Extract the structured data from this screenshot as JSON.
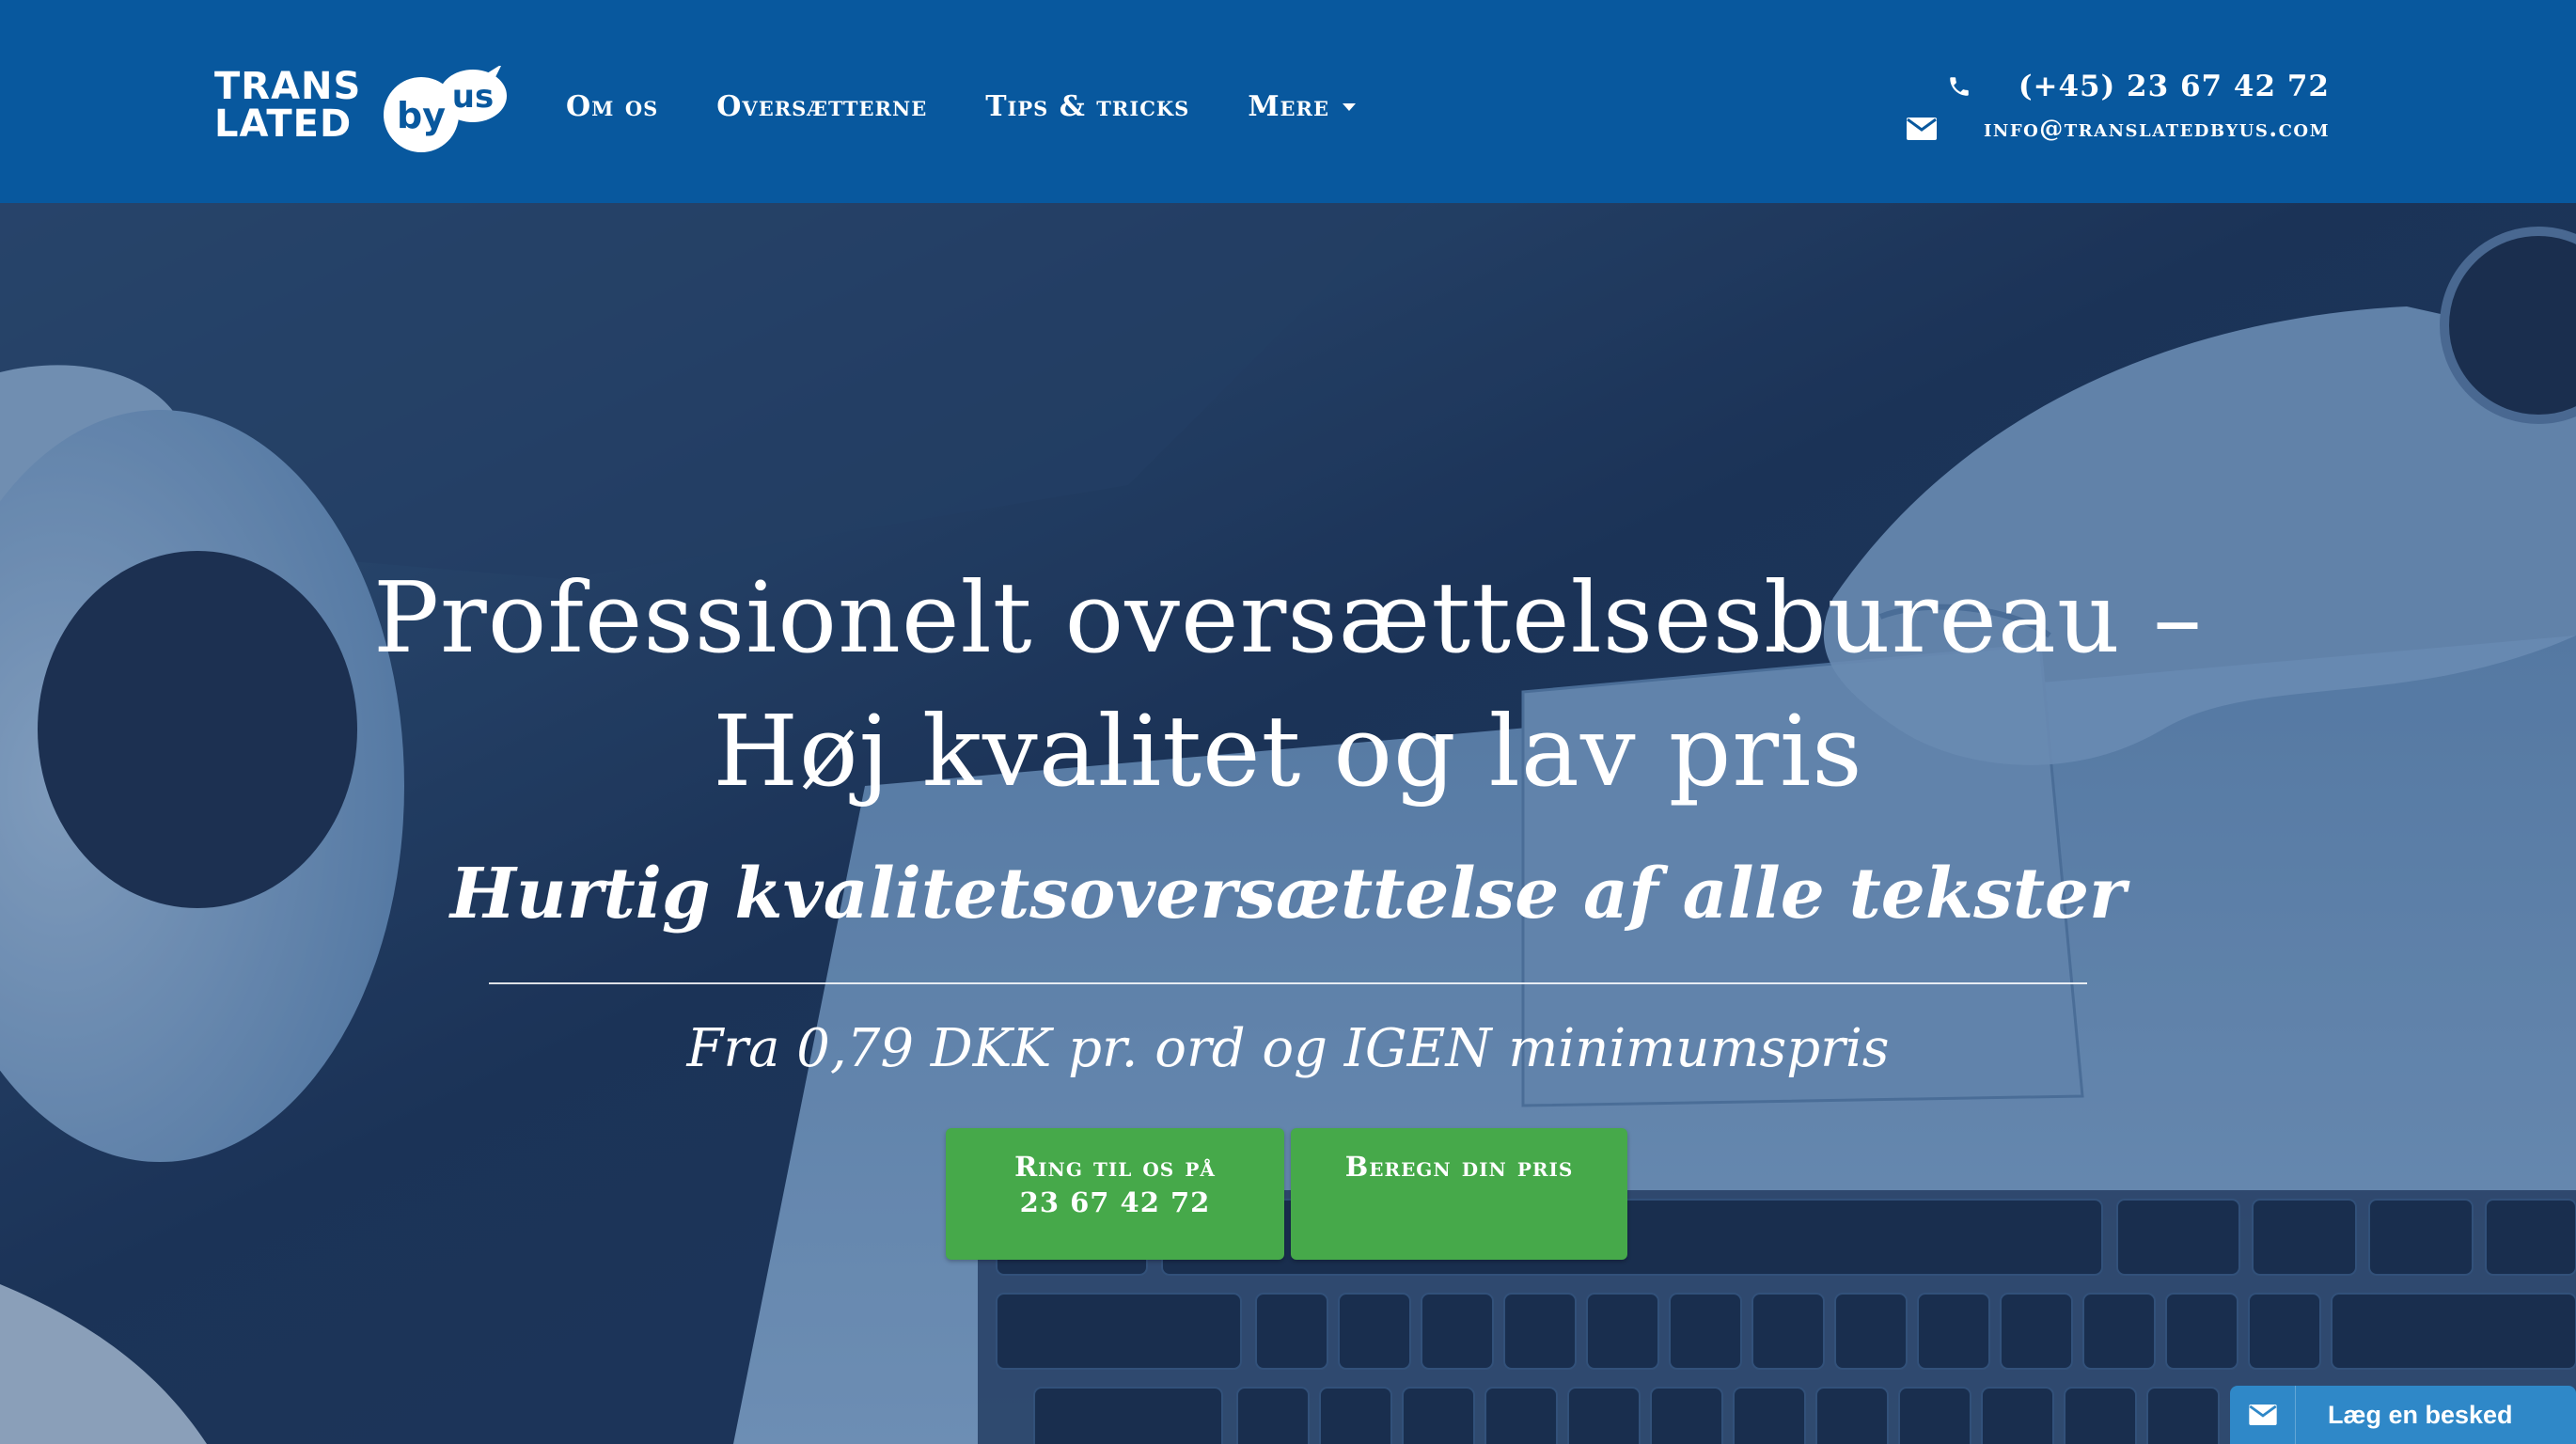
{
  "brand": {
    "logo_line1": "TRANS",
    "logo_line2": "LATED",
    "logo_by": "by",
    "logo_us": "us",
    "color_primary": "#08589e",
    "color_button": "#46a94a",
    "color_chat": "#2f88c8"
  },
  "nav": {
    "items": [
      {
        "label": "Om os"
      },
      {
        "label": "Oversætterne"
      },
      {
        "label": "Tips & tricks"
      },
      {
        "label": "Mere",
        "has_dropdown": true
      }
    ]
  },
  "contact": {
    "phone": "(+45) 23 67 42 72",
    "phone_icon": "phone-icon",
    "email": "info@translatedbyus.com",
    "email_icon": "envelope-icon"
  },
  "hero": {
    "title_line1": "Professionelt oversættelsesbureau –",
    "title_line2": "Høj kvalitet og lav pris",
    "subtitle": "Hurtig kvalitetsoversættelse af alle tekster",
    "price_line": "Fra 0,79 DKK pr. ord og IGEN minimumspris",
    "btn_call_line1": "Ring til os på",
    "btn_call_line2": "23 67 42 72",
    "btn_price": "Beregn din pris"
  },
  "chat": {
    "label": "Læg en besked",
    "icon": "envelope-icon"
  }
}
